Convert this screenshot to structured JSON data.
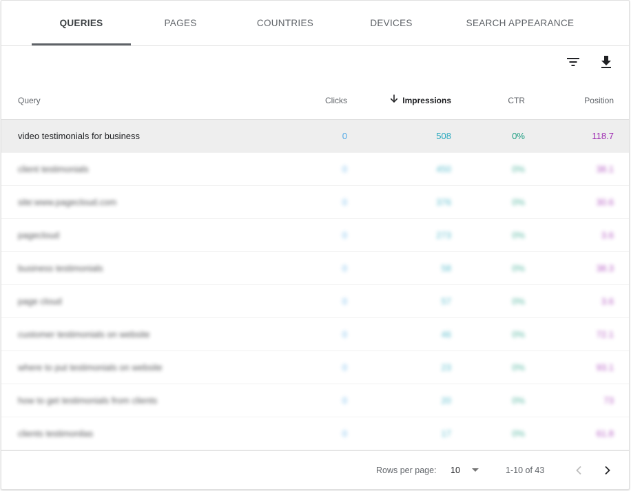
{
  "tabs": [
    {
      "label": "QUERIES",
      "active": true
    },
    {
      "label": "PAGES",
      "active": false
    },
    {
      "label": "COUNTRIES",
      "active": false
    },
    {
      "label": "DEVICES",
      "active": false
    },
    {
      "label": "SEARCH APPEARANCE",
      "active": false
    }
  ],
  "toolbar": {
    "filter_icon": "filter-icon",
    "download_icon": "download-icon"
  },
  "columns": {
    "query": "Query",
    "clicks": "Clicks",
    "impressions": "Impressions",
    "ctr": "CTR",
    "position": "Position",
    "sorted_by": "impressions",
    "sort_icon": "arrow-down-icon"
  },
  "colors": {
    "clicks": "#4fa8e6",
    "impressions": "#26a7bd",
    "ctr": "#1e9e82",
    "position": "#9c27b0"
  },
  "rows": [
    {
      "query": "video testimonials for business",
      "clicks": "0",
      "impressions": "508",
      "ctr": "0%",
      "position": "118.7",
      "highlighted": true,
      "blurred": false
    },
    {
      "query": "client testimonials",
      "clicks": "0",
      "impressions": "450",
      "ctr": "0%",
      "position": "38.1",
      "highlighted": false,
      "blurred": true
    },
    {
      "query": "site:www.pagecloud.com",
      "clicks": "0",
      "impressions": "376",
      "ctr": "0%",
      "position": "30.6",
      "highlighted": false,
      "blurred": true
    },
    {
      "query": "pagecloud",
      "clicks": "0",
      "impressions": "273",
      "ctr": "0%",
      "position": "3.6",
      "highlighted": false,
      "blurred": true
    },
    {
      "query": "business testimonials",
      "clicks": "0",
      "impressions": "58",
      "ctr": "0%",
      "position": "38.3",
      "highlighted": false,
      "blurred": true
    },
    {
      "query": "page cloud",
      "clicks": "0",
      "impressions": "57",
      "ctr": "0%",
      "position": "3.6",
      "highlighted": false,
      "blurred": true
    },
    {
      "query": "customer testimonials on website",
      "clicks": "0",
      "impressions": "46",
      "ctr": "0%",
      "position": "72.1",
      "highlighted": false,
      "blurred": true
    },
    {
      "query": "where to put testimonials on website",
      "clicks": "0",
      "impressions": "23",
      "ctr": "0%",
      "position": "93.1",
      "highlighted": false,
      "blurred": true
    },
    {
      "query": "how to get testimonials from clients",
      "clicks": "0",
      "impressions": "20",
      "ctr": "0%",
      "position": "73",
      "highlighted": false,
      "blurred": true
    },
    {
      "query": "clients testimonilas",
      "clicks": "0",
      "impressions": "17",
      "ctr": "0%",
      "position": "61.8",
      "highlighted": false,
      "blurred": true
    }
  ],
  "footer": {
    "rows_per_page_label": "Rows per page:",
    "rows_per_page_value": "10",
    "range": "1-10 of 43",
    "prev_icon": "chevron-left-icon",
    "next_icon": "chevron-right-icon"
  }
}
